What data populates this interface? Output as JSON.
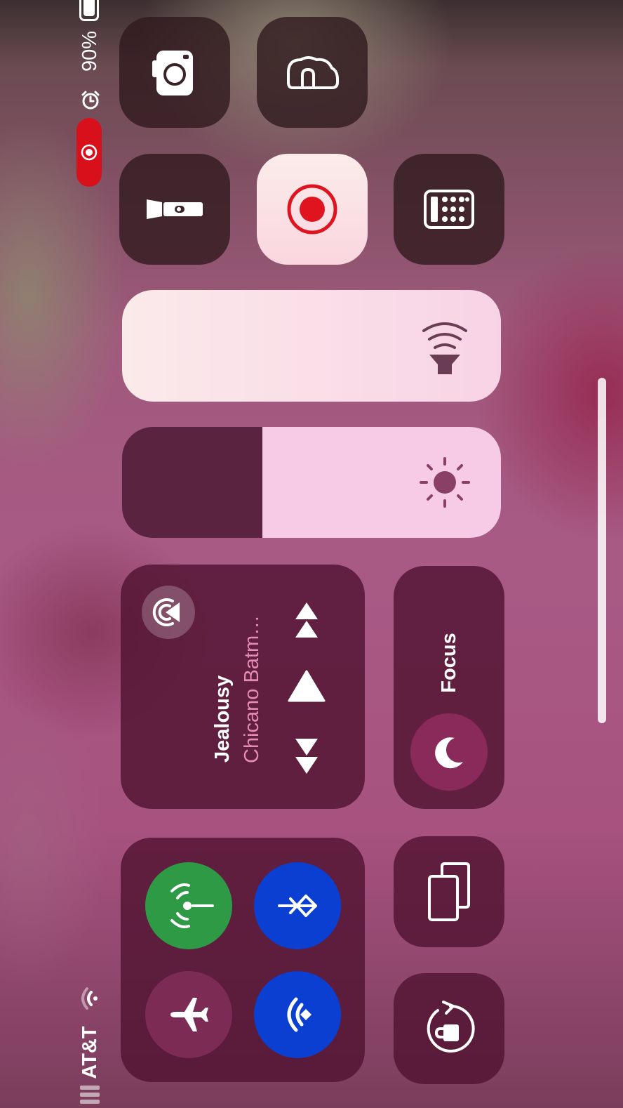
{
  "status_bar": {
    "carrier": "AT&T",
    "battery_percent": "90%",
    "battery_level": 0.9
  },
  "media": {
    "title": "Jealousy",
    "artist": "Chicano Batm…"
  },
  "focus": {
    "label": "Focus"
  },
  "sliders": {
    "volume_level": 1.0,
    "brightness_level": 0.63
  },
  "colors": {
    "cellular_active": "#2e9a45",
    "bluetooth_active": "#0a3fd1",
    "wifi_active": "#0a3fd1",
    "airplane_inactive": "#7c2b55",
    "record_active": "#e0141e",
    "focus_inactive": "#8a2a5a"
  },
  "icons": {
    "camera": "camera-icon",
    "home_cloud": "home-icon",
    "flashlight": "flashlight-icon",
    "screen_record": "record-icon",
    "calculator": "calculator-icon",
    "volume": "speaker-icon",
    "brightness": "sun-icon",
    "airplay": "airplay-icon",
    "play": "play-icon",
    "next": "next-track-icon",
    "previous": "previous-track-icon",
    "focus": "moon-icon",
    "cellular": "cellular-icon",
    "bluetooth": "bluetooth-icon",
    "airplane": "airplane-icon",
    "wifi": "wifi-icon",
    "screen_mirror": "screen-mirror-icon",
    "orientation_lock": "orientation-lock-icon",
    "alarm": "alarm-icon",
    "recording_indicator": "recording-indicator-icon"
  }
}
